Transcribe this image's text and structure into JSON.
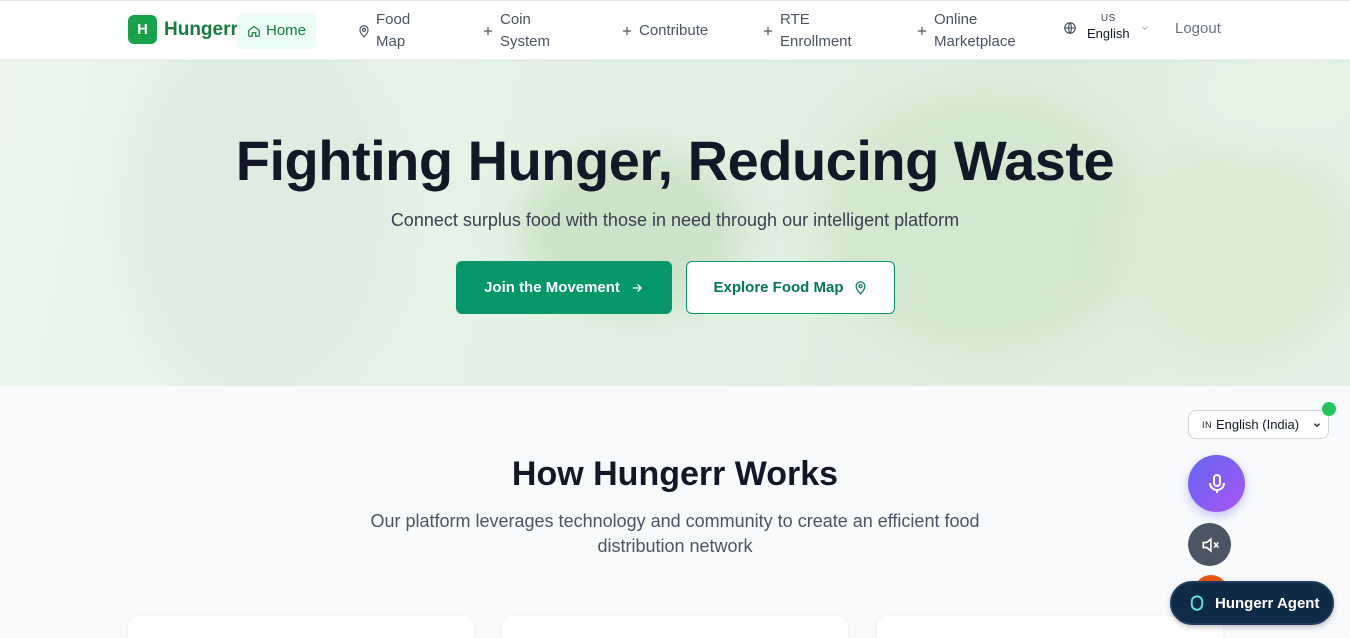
{
  "brand": {
    "mark": "H",
    "name": "Hungerr"
  },
  "nav": {
    "home": "Home",
    "food_map_1": "Food",
    "food_map_2": "Map",
    "coin_1": "Coin",
    "coin_2": "System",
    "contribute": "Contribute",
    "rte_1": "RTE",
    "rte_2": "Enrollment",
    "market_1": "Online",
    "market_2": "Marketplace",
    "lang_flag": "US",
    "lang_name": "English",
    "logout": "Logout"
  },
  "hero": {
    "title": "Fighting Hunger, Reducing Waste",
    "subtitle": "Connect surplus food with those in need through our intelligent platform",
    "primary_cta": "Join the Movement",
    "secondary_cta": "Explore Food Map"
  },
  "how": {
    "title": "How Hungerr Works",
    "subtitle": "Our platform leverages technology and community to create an efficient food distribution network"
  },
  "widgets": {
    "voice_flag": "IN",
    "voice_lang": "English (India)",
    "agent_label": "Hungerr Agent"
  },
  "colors": {
    "brand_green": "#16a34a",
    "cta_green": "#059669",
    "agent_navy": "#0f2a44",
    "mic_gradient_start": "#6366f1",
    "mic_gradient_end": "#a855f7"
  },
  "icons": {
    "home": "home-icon",
    "map": "map-pin-icon",
    "plus": "plus-icon",
    "globe": "globe-icon",
    "arrow": "arrow-right-icon",
    "mic": "microphone-icon",
    "mute": "volume-mute-icon",
    "agent": "agent-ring-icon"
  }
}
